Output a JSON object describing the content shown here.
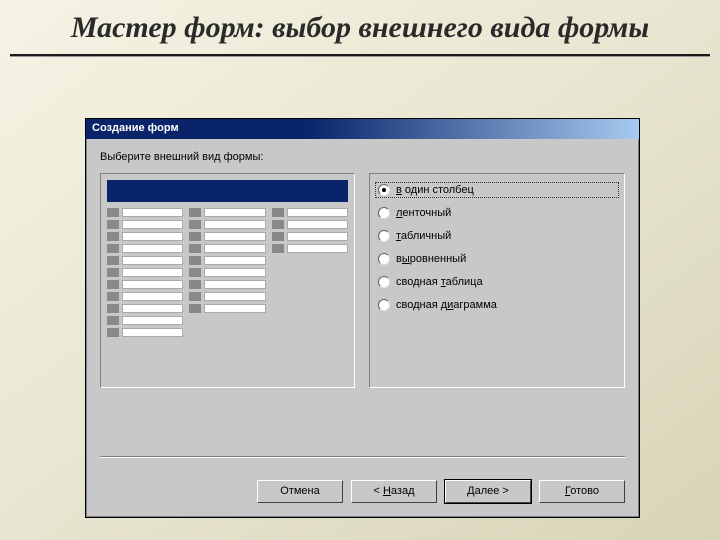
{
  "slide": {
    "title": "Мастер форм: выбор внешнего вида формы"
  },
  "dialog": {
    "title": "Создание форм",
    "instruction": "Выберите внешний вид формы:",
    "options": [
      {
        "label": "в один столбец",
        "underline": 0,
        "checked": true
      },
      {
        "label": "ленточный",
        "underline": 0,
        "checked": false
      },
      {
        "label": "табличный",
        "underline": 0,
        "checked": false
      },
      {
        "label": "выровненный",
        "underline": 1,
        "checked": false
      },
      {
        "label": "сводная таблица",
        "underline": 8,
        "checked": false
      },
      {
        "label": "сводная диаграмма",
        "underline": 9,
        "checked": false
      }
    ],
    "buttons": {
      "cancel": "Отмена",
      "back": "< Назад",
      "next": "Далее >",
      "finish": "Готово"
    }
  }
}
